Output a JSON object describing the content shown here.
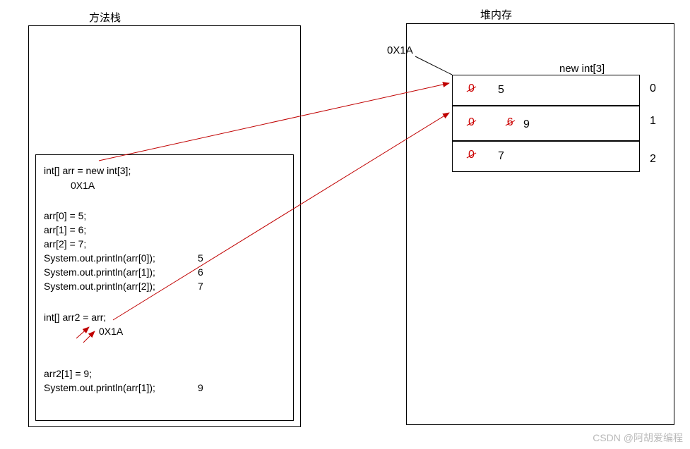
{
  "titles": {
    "stack": "方法栈",
    "heap": "堆内存"
  },
  "stack": {
    "code": {
      "l1": "int[] arr = new int[3];",
      "addr1": "0X1A",
      "l2": "arr[0] = 5;",
      "l3": "arr[1] = 6;",
      "l4": "arr[2] = 7;",
      "l5": "System.out.println(arr[0]);",
      "l6": "System.out.println(arr[1]);",
      "l7": "System.out.println(arr[2]);",
      "out5": "5",
      "out6": "6",
      "out7": "7",
      "l8": "int[] arr2 = arr;",
      "addr2": "0X1A",
      "l9": "arr2[1] = 9;",
      "l10": "System.out.println(arr[1]);",
      "out9": "9"
    }
  },
  "heap": {
    "addrLabel": "0X1A",
    "newLabel": "new int[3]",
    "cells": [
      {
        "old": "0",
        "newv": "5",
        "extra": "",
        "index": "0"
      },
      {
        "old": "0",
        "newv": "6",
        "extra": "9",
        "index": "1"
      },
      {
        "old": "0",
        "newv": "7",
        "extra": "",
        "index": "2"
      }
    ]
  },
  "watermark": "CSDN @阿胡爱编程"
}
